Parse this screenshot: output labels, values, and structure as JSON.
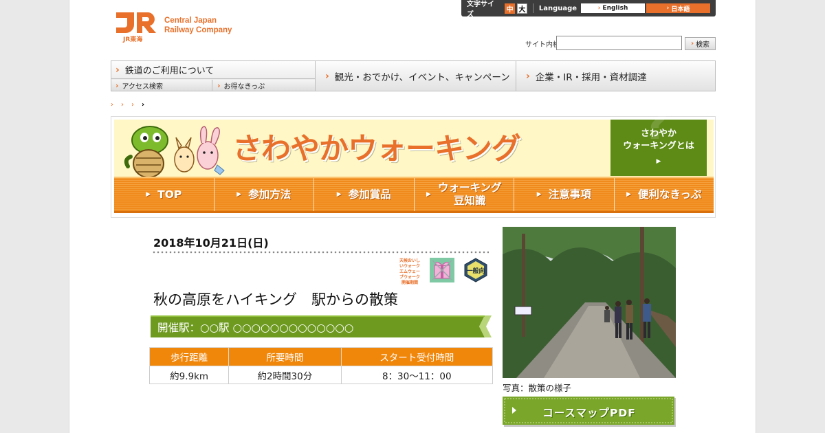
{
  "logo": {
    "mark": "JR東海",
    "line1": "Central Japan",
    "line2": "Railway Company"
  },
  "util": {
    "text_size_label": "文字サイズ",
    "size_medium": "中",
    "size_large": "大",
    "language_label": "Language",
    "lang_english": "English",
    "lang_japanese": "日本語"
  },
  "search": {
    "label": "サイト内検索",
    "button": "検索",
    "value": ""
  },
  "gnav": {
    "rail": "鉄道のご利用について",
    "access": "アクセス検索",
    "tickets": "お得なきっぷ",
    "tourism": "観光・おでかけ、イベント、キャンペーン",
    "corporate": "企業・IR・採用・資材調達"
  },
  "banner": {
    "title": "さわやかウォーキング",
    "what_is": [
      "さわやか",
      "ウォーキングとは"
    ]
  },
  "subnav": [
    {
      "label": "TOP"
    },
    {
      "label": "参加方法"
    },
    {
      "label": "参加賞品"
    },
    {
      "label": "ウォーキング\n豆知識"
    },
    {
      "label": "注意事項"
    },
    {
      "label": "便利なきっぷ"
    }
  ],
  "event": {
    "date": "2018年10月21日(日)",
    "badge_label": "天候おいしいウォーク エムウェーブウォーク 開催期間",
    "general_badge": "一般向",
    "title": "秋の高原をハイキング　駅からの散策",
    "green_bar": "開催駅：○○駅 ○○○○○○○○○○○○○",
    "table": {
      "headers": [
        "歩行距離",
        "所要時間",
        "スタート受付時間"
      ],
      "values": [
        "約9.9km",
        "約2時間30分",
        "8：30～11：00"
      ]
    },
    "photo_caption": "写真：散策の様子",
    "pdf_button": "コースマップPDF"
  },
  "colors": {
    "accent": "#e8702a",
    "nav_orange": "#f08a1c",
    "green": "#5d8b16",
    "banner_bg": "#fff8c6"
  }
}
